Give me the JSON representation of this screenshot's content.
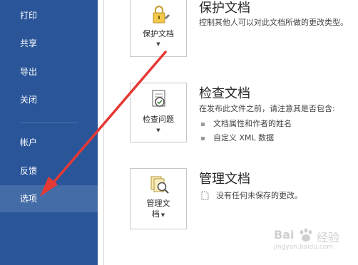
{
  "sidebar": {
    "items": [
      {
        "label": "打印"
      },
      {
        "label": "共享"
      },
      {
        "label": "导出"
      },
      {
        "label": "关闭"
      },
      {
        "label": "帐户"
      },
      {
        "label": "反馈"
      },
      {
        "label": "选项",
        "selected": true
      }
    ]
  },
  "protect": {
    "button_label": "保护文档",
    "title": "保护文档",
    "desc": "控制其他人可以对此文档所做的更改类型。"
  },
  "inspect": {
    "button_label": "检查问题",
    "title": "检查文档",
    "desc": "在发布此文件之前，请注意其是否包含:",
    "bullets": [
      "文档属性和作者的姓名",
      "自定义 XML 数据"
    ]
  },
  "manage": {
    "button_label_line1": "管理文",
    "button_label_line2": "档",
    "title": "管理文档",
    "desc": "没有任何未保存的更改。"
  },
  "watermark": {
    "brand": "Bai",
    "product": "经验",
    "url": "jingyan.baidu.com"
  },
  "colors": {
    "sidebar": "#2a5699",
    "selected_item": "#446ca6",
    "arrow": "#e53935"
  }
}
